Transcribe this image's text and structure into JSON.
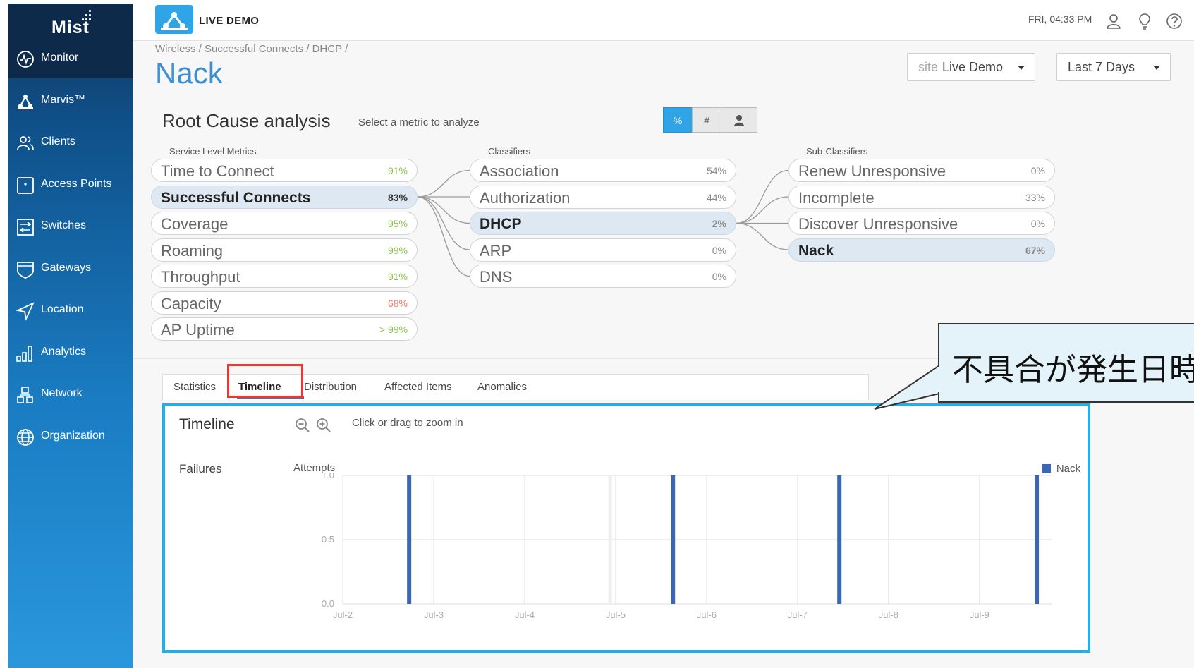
{
  "sidebar": {
    "logo": "Mist",
    "items": [
      {
        "label": "Monitor",
        "icon": "monitor-icon"
      },
      {
        "label": "Marvis™",
        "icon": "marvis-icon"
      },
      {
        "label": "Clients",
        "icon": "clients-icon"
      },
      {
        "label": "Access Points",
        "icon": "access-point-icon"
      },
      {
        "label": "Switches",
        "icon": "switch-icon"
      },
      {
        "label": "Gateways",
        "icon": "gateway-icon"
      },
      {
        "label": "Location",
        "icon": "location-icon"
      },
      {
        "label": "Analytics",
        "icon": "analytics-icon"
      },
      {
        "label": "Network",
        "icon": "network-icon"
      },
      {
        "label": "Organization",
        "icon": "globe-icon"
      }
    ]
  },
  "topbar": {
    "brand": "LIVE DEMO",
    "clock": "FRI, 04:33 PM"
  },
  "breadcrumb": "Wireless / Successful Connects / DHCP /",
  "page_title": "Nack",
  "site_selector": {
    "prefix": "site",
    "value": "Live Demo"
  },
  "range_selector": {
    "value": "Last 7 Days"
  },
  "rca": {
    "title": "Root Cause analysis",
    "subtitle": "Select a metric to analyze",
    "toggle": {
      "percent": "%",
      "count": "#"
    }
  },
  "service_level": {
    "header": "Service Level Metrics",
    "items": [
      {
        "name": "Time to Connect",
        "value": "91%"
      },
      {
        "name": "Successful Connects",
        "value": "83%"
      },
      {
        "name": "Coverage",
        "value": "95%"
      },
      {
        "name": "Roaming",
        "value": "99%"
      },
      {
        "name": "Throughput",
        "value": "91%"
      },
      {
        "name": "Capacity",
        "value": "68%"
      },
      {
        "name": "AP Uptime",
        "value": "> 99%"
      }
    ]
  },
  "classifiers": {
    "header": "Classifiers",
    "items": [
      {
        "name": "Association",
        "value": "54%"
      },
      {
        "name": "Authorization",
        "value": "44%"
      },
      {
        "name": "DHCP",
        "value": "2%"
      },
      {
        "name": "ARP",
        "value": "0%"
      },
      {
        "name": "DNS",
        "value": "0%"
      }
    ]
  },
  "subclassifiers": {
    "header": "Sub-Classifiers",
    "items": [
      {
        "name": "Renew Unresponsive",
        "value": "0%"
      },
      {
        "name": "Incomplete",
        "value": "33%"
      },
      {
        "name": "Discover Unresponsive",
        "value": "0%"
      },
      {
        "name": "Nack",
        "value": "67%"
      }
    ]
  },
  "tabs": [
    "Statistics",
    "Timeline",
    "Distribution",
    "Affected Items",
    "Anomalies"
  ],
  "timeline": {
    "title": "Timeline",
    "hint": "Click or drag to zoom in",
    "failures_label": "Failures",
    "attempts_label": "Attempts"
  },
  "callout": {
    "text": "不具合が発生日時"
  },
  "colors": {
    "accent": "#2fa4e7",
    "bar": "#3a66b8",
    "highlight": "#e53935",
    "panel_border": "#22aee6"
  },
  "chart_data": {
    "type": "bar",
    "ylim": [
      0,
      1.0
    ],
    "yticks": [
      "1.0",
      "0.5",
      "0.0"
    ],
    "xticks": [
      "Jul-2",
      "Jul-3",
      "Jul-4",
      "Jul-5",
      "Jul-6",
      "Jul-7",
      "Jul-8",
      "Jul-9"
    ],
    "xrange": [
      0,
      7.8
    ],
    "series": [
      {
        "name": "Nack",
        "x": [
          0.73,
          3.63,
          5.46,
          7.63
        ],
        "values": [
          1,
          1,
          1,
          1
        ]
      }
    ]
  }
}
